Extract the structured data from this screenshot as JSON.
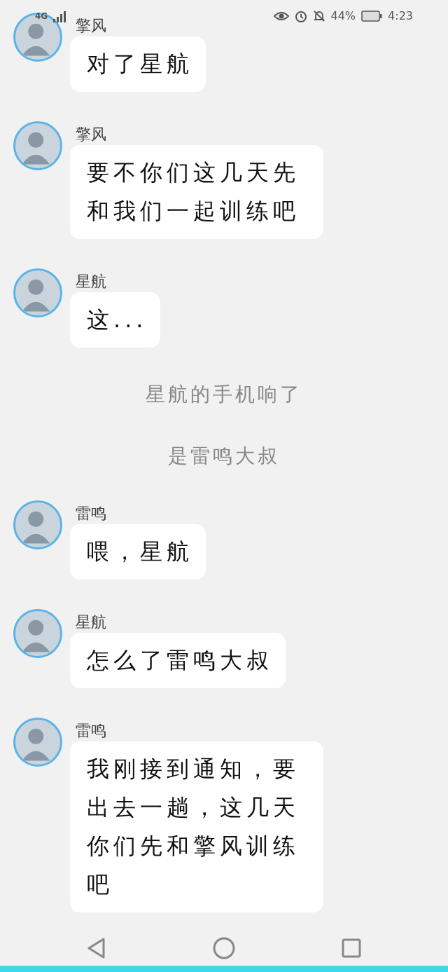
{
  "status_bar": {
    "network": "4G",
    "battery": "44%",
    "time": "4:23"
  },
  "messages": [
    {
      "kind": "message",
      "sender": "擎风",
      "text": "对了星航"
    },
    {
      "kind": "message",
      "sender": "擎风",
      "text": "要不你们这几天先和我们一起训练吧"
    },
    {
      "kind": "message",
      "sender": "星航",
      "text": "这..."
    },
    {
      "kind": "notice",
      "text": "星航的手机响了"
    },
    {
      "kind": "notice",
      "text": "是雷鸣大叔"
    },
    {
      "kind": "message",
      "sender": "雷鸣",
      "text": "喂，星航"
    },
    {
      "kind": "message",
      "sender": "星航",
      "text": "怎么了雷鸣大叔"
    },
    {
      "kind": "message",
      "sender": "雷鸣",
      "text": "我刚接到通知，要出去一趟，这几天你们先和擎风训练吧"
    }
  ]
}
